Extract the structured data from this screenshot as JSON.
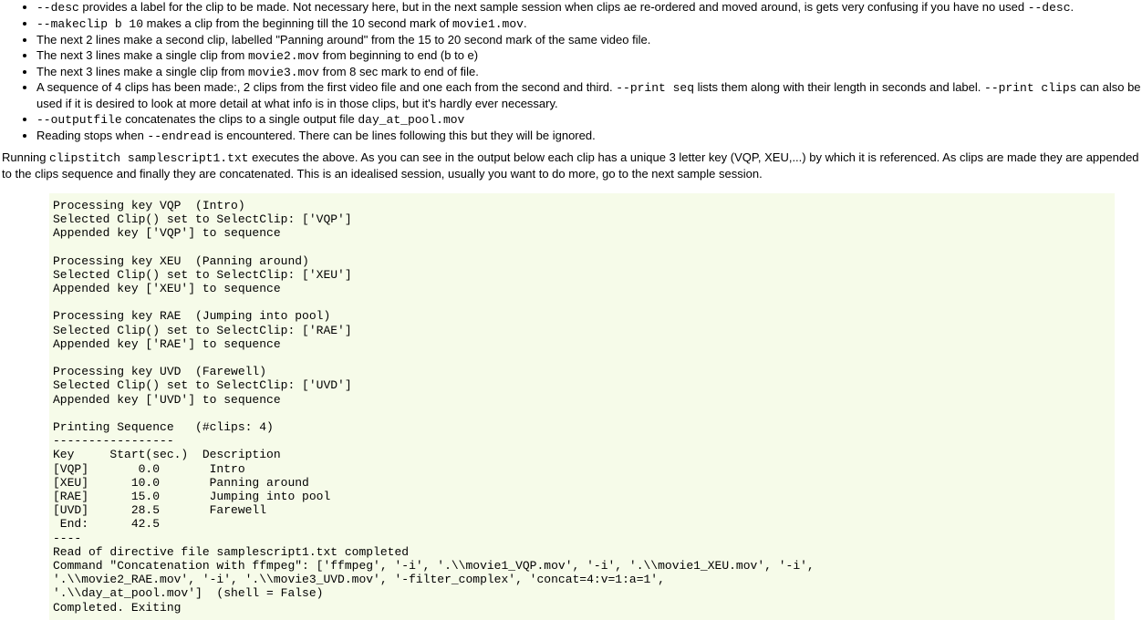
{
  "bullets": {
    "b1": {
      "code1": "--desc",
      "text1": " provides a label for the clip to be made. Not necessary here, but in the next sample session when clips ae re-ordered and moved around, is gets very confusing if you have no used ",
      "code2": "--desc",
      "text2": "."
    },
    "b2": {
      "code1": "--makeclip b 10",
      "text1": " makes a clip from the beginning till the 10 second mark of ",
      "code2": "movie1.mov",
      "text2": "."
    },
    "b3": "The next 2 lines make a second clip, labelled \"Panning around\" from the 15 to 20 second mark of the same video file.",
    "b4": {
      "text1": "The next 3 lines make a single clip from ",
      "code1": "movie2.mov",
      "text2": " from beginning to end (b to e)"
    },
    "b5": {
      "text1": "The next 3 lines make a single clip from ",
      "code1": "movie3.mov",
      "text2": " from 8 sec mark to end of file."
    },
    "b6": {
      "text1": "A sequence of 4 clips has been made:, 2 clips from the first video file and one each from the second and third. ",
      "code1": "--print seq",
      "text2": " lists them along with their length in seconds and label. ",
      "code2": "--print clips",
      "text3": " can also be used if it is desired to look at more detail at what info is in those clips, but it's hardly ever necessary."
    },
    "b7": {
      "code1": "--outputfile",
      "text1": " concatenates the clips to a single output file ",
      "code2": "day_at_pool.mov"
    },
    "b8": {
      "text1": "Reading stops when ",
      "code1": "--endread",
      "text2": " is encountered. There can be lines following this but they will be ignored."
    }
  },
  "running": {
    "t1": "Running ",
    "c1": "clipstitch samplescript1.txt",
    "t2": " executes the above. As you can see in the output below each clip has a unique 3 letter key (VQP, XEU,...) by which it is referenced. As clips are made they are appended to the clips sequence and finally they are concatenated. This is an idealised session, usually you want to do more, go to the next sample session."
  },
  "output": "Processing key VQP  (Intro)\nSelected Clip() set to SelectClip: ['VQP']\nAppended key ['VQP'] to sequence\n\nProcessing key XEU  (Panning around)\nSelected Clip() set to SelectClip: ['XEU']\nAppended key ['XEU'] to sequence\n\nProcessing key RAE  (Jumping into pool)\nSelected Clip() set to SelectClip: ['RAE']\nAppended key ['RAE'] to sequence\n\nProcessing key UVD  (Farewell)\nSelected Clip() set to SelectClip: ['UVD']\nAppended key ['UVD'] to sequence\n\nPrinting Sequence   (#clips: 4)\n-----------------\nKey     Start(sec.)  Description\n[VQP]       0.0       Intro\n[XEU]      10.0       Panning around\n[RAE]      15.0       Jumping into pool\n[UVD]      28.5       Farewell\n End:      42.5\n----\nRead of directive file samplescript1.txt completed\nCommand \"Concatenation with ffmpeg\": ['ffmpeg', '-i', '.\\\\movie1_VQP.mov', '-i', '.\\\\movie1_XEU.mov', '-i',\n'.\\\\movie2_RAE.mov', '-i', '.\\\\movie3_UVD.mov', '-filter_complex', 'concat=4:v=1:a=1',\n'.\\\\day_at_pool.mov']  (shell = False)\nCompleted. Exiting"
}
